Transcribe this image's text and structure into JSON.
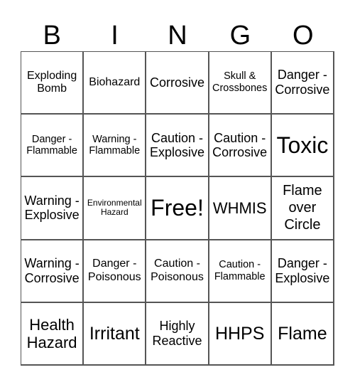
{
  "header": [
    "B",
    "I",
    "N",
    "G",
    "O"
  ],
  "cells": [
    [
      "Exploding Bomb",
      "Biohazard",
      "Corrosive",
      "Skull & Crossbones",
      "Danger - Corrosive"
    ],
    [
      "Danger - Flammable",
      "Warning - Flammable",
      "Caution - Explosive",
      "Caution - Corrosive",
      "Toxic"
    ],
    [
      "Warning - Explosive",
      "Environmental Hazard",
      "Free!",
      "WHMIS",
      "Flame over Circle"
    ],
    [
      "Warning - Corrosive",
      "Danger - Poisonous",
      "Caution - Poisonous",
      "Caution - Flammable",
      "Danger - Explosive"
    ],
    [
      "Health Hazard",
      "Irritant",
      "Highly Reactive",
      "HHPS",
      "Flame"
    ]
  ]
}
